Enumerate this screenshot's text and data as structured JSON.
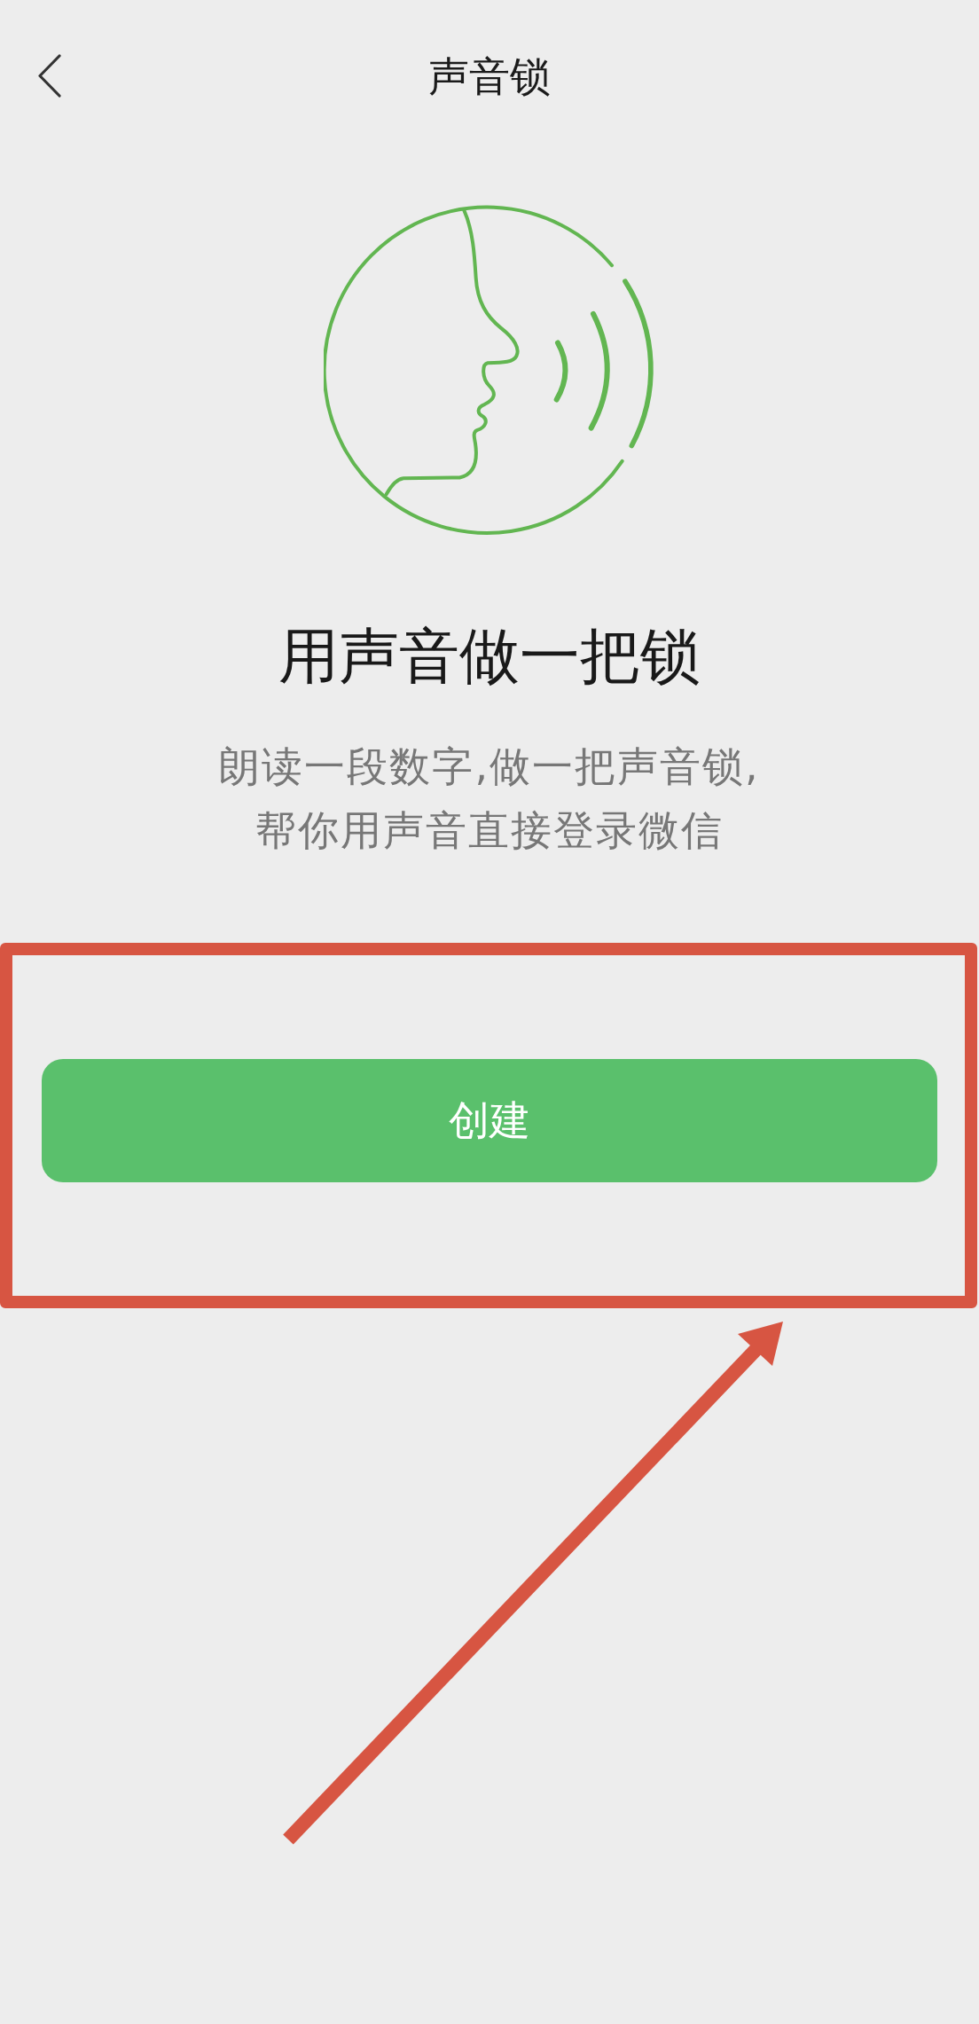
{
  "header": {
    "title": "声音锁"
  },
  "intro": {
    "heading": "用声音做一把锁",
    "description": [
      "朗读一段数字,做一把声音锁,",
      "帮你用声音直接登录微信"
    ]
  },
  "primary_button": {
    "label": "创建"
  }
}
